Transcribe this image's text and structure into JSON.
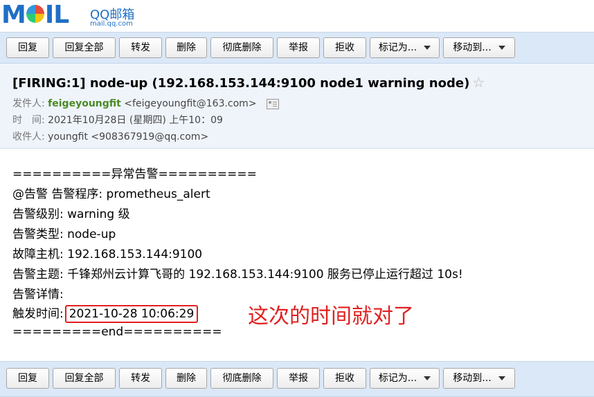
{
  "logo": {
    "brand": "MAIL",
    "name": "QQ邮箱",
    "domain": "mail.qq.com"
  },
  "toolbar": {
    "reply": "回复",
    "reply_all": "回复全部",
    "forward": "转发",
    "delete": "删除",
    "delete_permanently": "彻底删除",
    "report": "举报",
    "reject": "拒收",
    "mark_as": "标记为...",
    "move_to": "移动到..."
  },
  "email": {
    "subject": "[FIRING:1] node-up (192.168.153.144:9100 node1 warning node)",
    "from_label": "发件人:",
    "from_name": "feigeyoungfit",
    "from_addr": "<feigeyoungfit@163.com>",
    "time_label": "时　间:",
    "time": "2021年10月28日 (星期四) 上午10：09",
    "to_label": "收件人:",
    "to_name": "youngfit",
    "to_addr": "<908367919@qq.com>"
  },
  "body": {
    "line1": "==========异常告警==========",
    "line2": "@告警 告警程序: prometheus_alert",
    "line3": "告警级别: warning 级",
    "line4": "告警类型: node-up",
    "line5": "故障主机: 192.168.153.144:9100",
    "line6": "告警主题: 千锋郑州云计算飞哥的 192.168.153.144:9100 服务已停止运行超过 10s!",
    "line7": "告警详情:",
    "trigger_label": "触发时间:",
    "trigger_time": "2021-10-28 10:06:29",
    "line9": "=========end=========="
  },
  "annotation": "这次的时间就对了",
  "colors": {
    "toolbar_bg": "#dbe8f7",
    "subject_bg": "#eff4fb",
    "sender": "#4a8a25",
    "annotation": "#e02020"
  }
}
